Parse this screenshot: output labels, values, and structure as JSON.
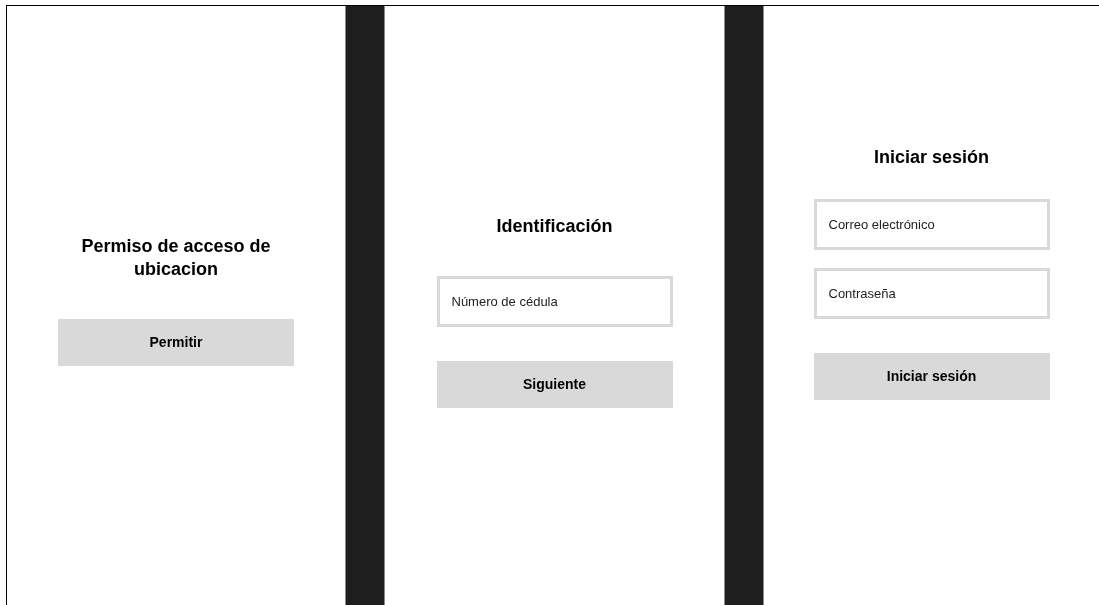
{
  "screens": [
    {
      "title": "Permiso de acceso de ubicacion",
      "button": "Permitir"
    },
    {
      "title": "Identificación",
      "fields": [
        {
          "placeholder": "Número de cédula"
        }
      ],
      "button": "Siguiente"
    },
    {
      "title": "Iniciar sesión",
      "fields": [
        {
          "placeholder": "Correo electrónico"
        },
        {
          "placeholder": "Contraseña"
        }
      ],
      "button": "Iniciar sesión"
    }
  ]
}
